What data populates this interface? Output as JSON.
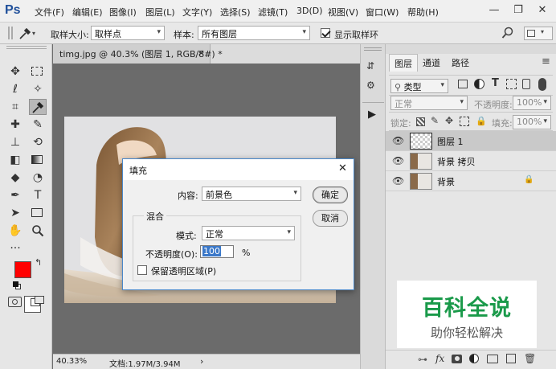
{
  "app": {
    "logo": "Ps"
  },
  "menu": [
    "文件(F)",
    "编辑(E)",
    "图像(I)",
    "图层(L)",
    "文字(Y)",
    "选择(S)",
    "滤镜(T)",
    "3D(D)",
    "视图(V)",
    "窗口(W)",
    "帮助(H)"
  ],
  "window_controls": {
    "minimize": "—",
    "restore": "❐",
    "close": "✕"
  },
  "options": {
    "sample_size_label": "取样大小:",
    "sample_size_value": "取样点",
    "sample_label": "样本:",
    "sample_value": "所有图层",
    "show_ring_label": "显示取样环",
    "show_ring_checked": true
  },
  "document": {
    "tab_title": "timg.jpg @ 40.3% (图层 1, RGB/8#) *",
    "tab_close": "×",
    "zoom": "40.33%",
    "doc_size": "文档:1.97M/3.94M",
    "status_arrow": "›"
  },
  "layers_panel": {
    "tabs": [
      "图层",
      "通道",
      "路径"
    ],
    "active_tab": "图层",
    "kind_filter": "类型",
    "blend_mode": "正常",
    "opacity_label": "不透明度:",
    "opacity_value": "100%",
    "lock_label": "锁定:",
    "fill_label": "填充:",
    "fill_value": "100%",
    "layers": [
      {
        "name": "图层 1",
        "selected": true,
        "locked": false
      },
      {
        "name": "背景 拷贝",
        "selected": false,
        "locked": false
      },
      {
        "name": "背景",
        "selected": false,
        "locked": true
      }
    ]
  },
  "watermark": {
    "title": "百科全说",
    "subtitle": "助你轻松解决"
  },
  "fill_dialog": {
    "title": "填充",
    "close": "✕",
    "contents_label": "内容:",
    "contents_value": "前景色",
    "blend_group_label": "混合",
    "mode_label": "模式:",
    "mode_value": "正常",
    "opacity_label": "不透明度(O):",
    "opacity_value": "100",
    "opacity_unit": "%",
    "preserve_label": "保留透明区域(P)",
    "preserve_checked": false,
    "ok_label": "确定",
    "cancel_label": "取消"
  },
  "colors": {
    "foreground": "#ff0000",
    "background": "#ffffff",
    "accent": "#1f4f9a",
    "watermark_green": "#1a9a4a"
  }
}
